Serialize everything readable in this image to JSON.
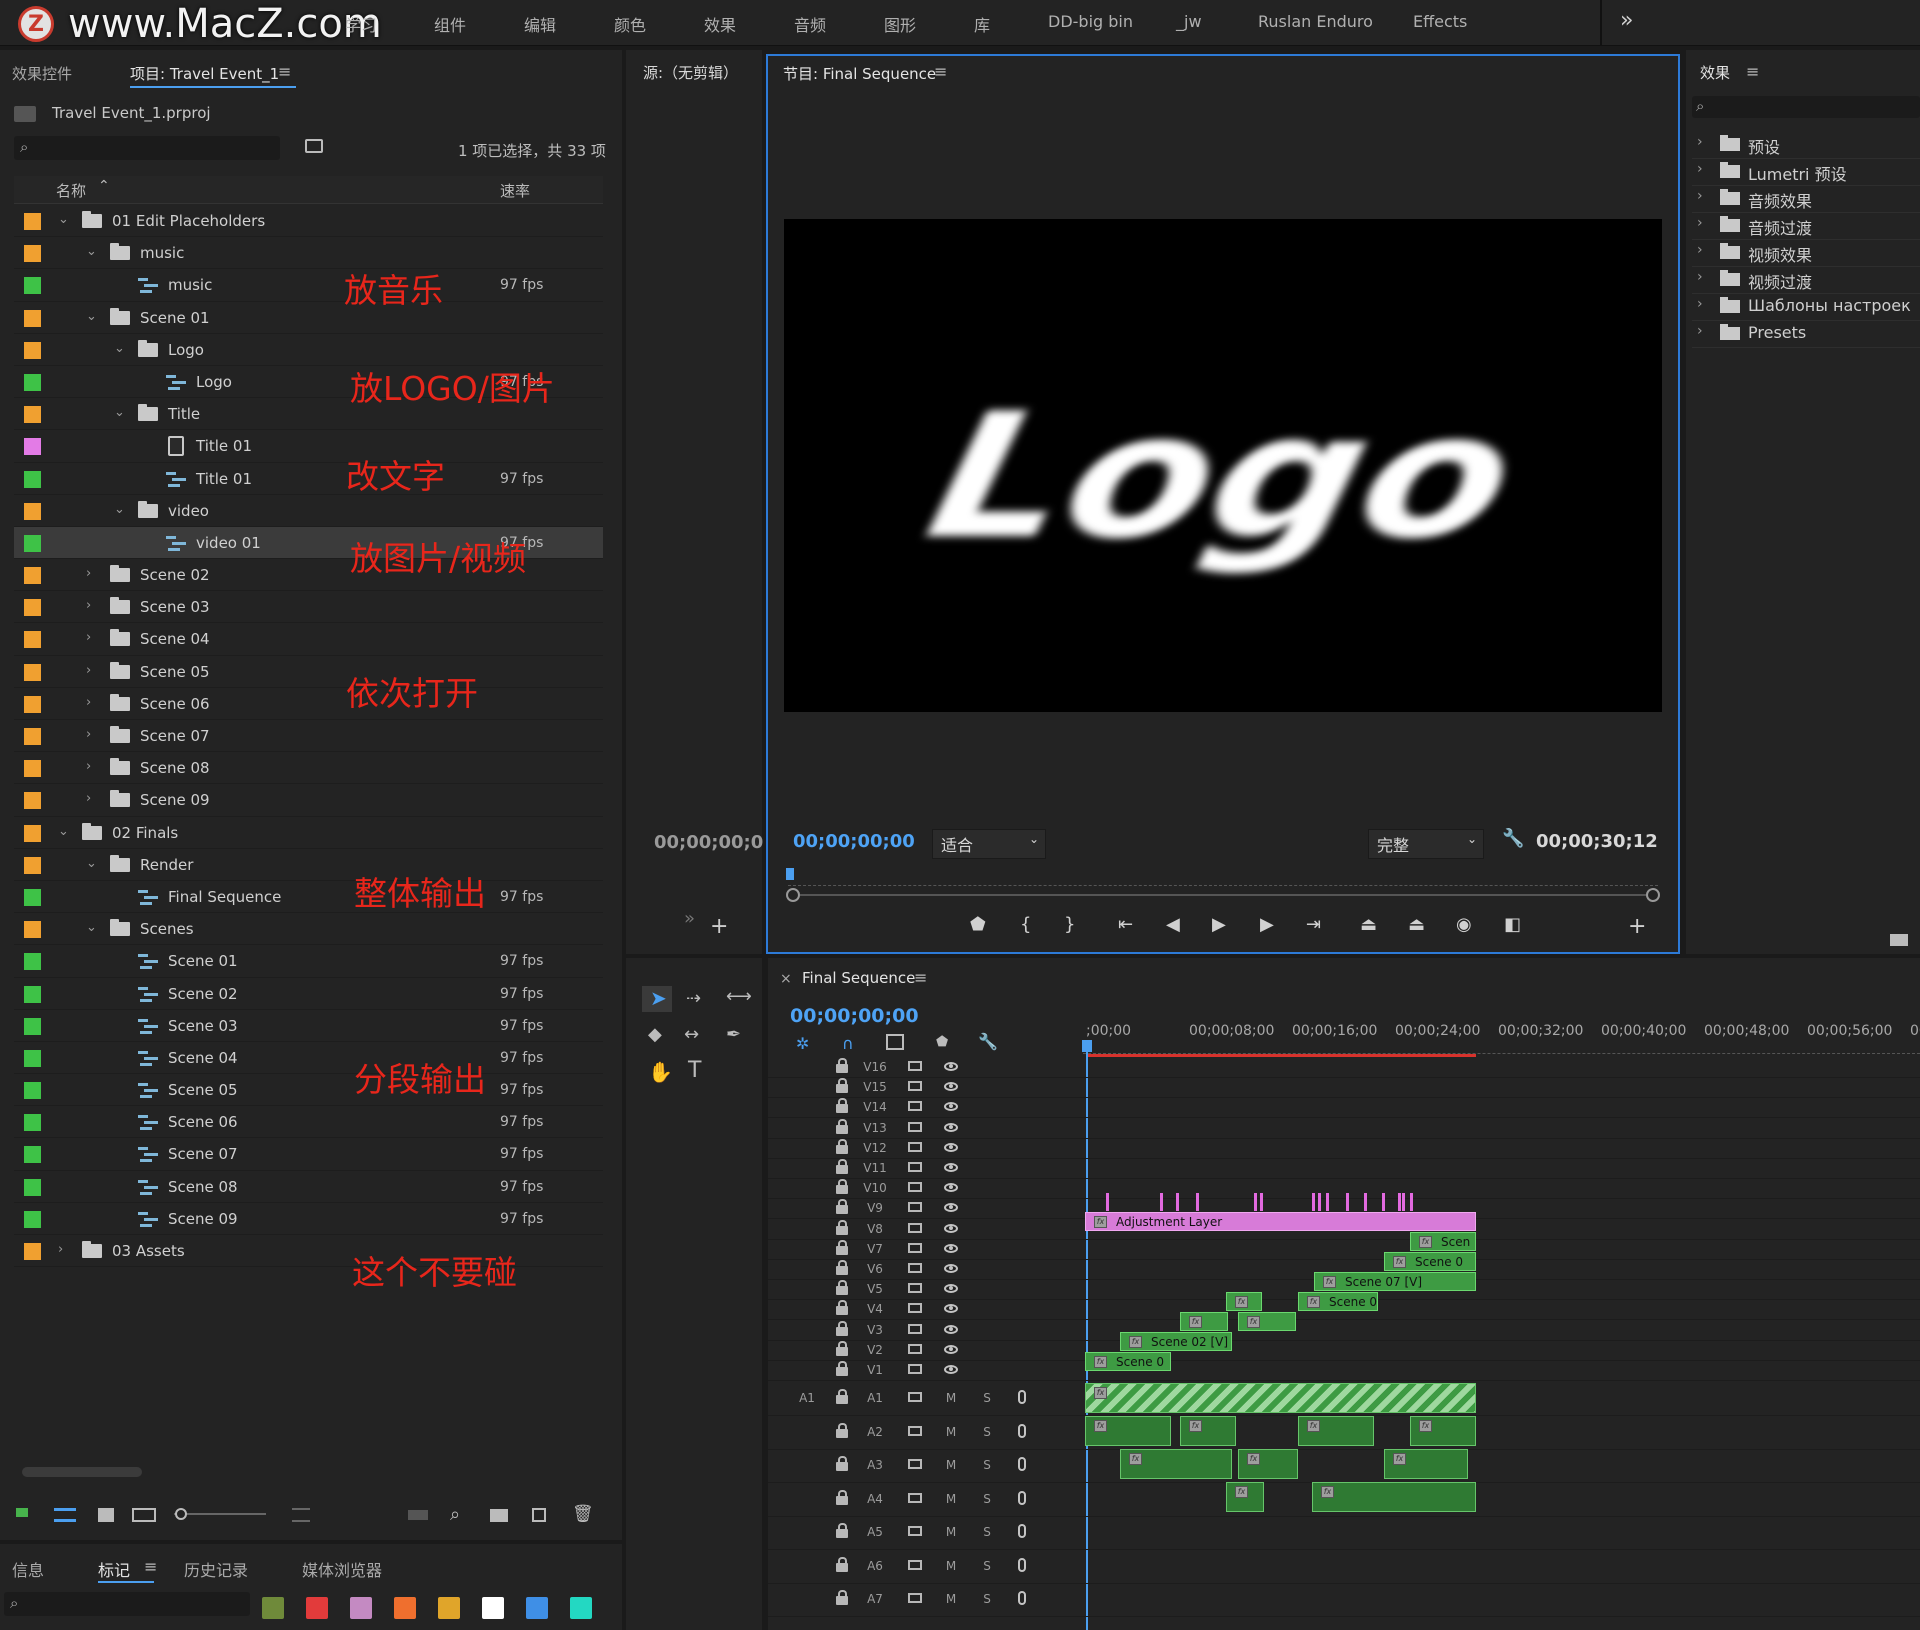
{
  "watermark": {
    "logo_letter": "Z",
    "text": "www.MacZ.com"
  },
  "workspace_tabs": [
    "学习",
    "组件",
    "编辑",
    "颜色",
    "效果",
    "音频",
    "图形",
    "库",
    "DD-big bin",
    "_jw",
    "Ruslan Enduro",
    "Effects"
  ],
  "workspace_more": "»",
  "project_panel": {
    "tab_effect_controls": "效果控件",
    "tab_project": "项目: Travel Event_1",
    "file_name": "Travel Event_1.prproj",
    "selection_status": "1 项已选择，共 33 项",
    "col_name": "名称",
    "col_rate": "速率",
    "rows": [
      {
        "name": "01 Edit Placeholders",
        "type": "bin",
        "indent": 0,
        "chip": "#f0a030",
        "twirl": "open",
        "fps": ""
      },
      {
        "name": "music",
        "type": "bin",
        "indent": 1,
        "chip": "#f0a030",
        "twirl": "open",
        "fps": ""
      },
      {
        "name": "music",
        "type": "seq",
        "indent": 2,
        "chip": "#3ec247",
        "twirl": "",
        "fps": "97 fps"
      },
      {
        "name": "Scene 01",
        "type": "bin",
        "indent": 1,
        "chip": "#f0a030",
        "twirl": "open",
        "fps": ""
      },
      {
        "name": "Logo",
        "type": "bin",
        "indent": 2,
        "chip": "#f0a030",
        "twirl": "open",
        "fps": ""
      },
      {
        "name": "Logo",
        "type": "seq",
        "indent": 3,
        "chip": "#3ec247",
        "twirl": "",
        "fps": "97 fps"
      },
      {
        "name": "Title",
        "type": "bin",
        "indent": 2,
        "chip": "#f0a030",
        "twirl": "open",
        "fps": ""
      },
      {
        "name": "Title 01",
        "type": "title",
        "indent": 3,
        "chip": "#e37be6",
        "twirl": "",
        "fps": ""
      },
      {
        "name": "Title 01",
        "type": "seq",
        "indent": 3,
        "chip": "#3ec247",
        "twirl": "",
        "fps": "97 fps"
      },
      {
        "name": "video",
        "type": "bin",
        "indent": 2,
        "chip": "#f0a030",
        "twirl": "open",
        "fps": ""
      },
      {
        "name": "video 01",
        "type": "seq",
        "indent": 3,
        "chip": "#3ec247",
        "twirl": "",
        "fps": "97 fps",
        "selected": true
      },
      {
        "name": "Scene 02",
        "type": "bin",
        "indent": 1,
        "chip": "#f0a030",
        "twirl": "closed",
        "fps": ""
      },
      {
        "name": "Scene 03",
        "type": "bin",
        "indent": 1,
        "chip": "#f0a030",
        "twirl": "closed",
        "fps": ""
      },
      {
        "name": "Scene 04",
        "type": "bin",
        "indent": 1,
        "chip": "#f0a030",
        "twirl": "closed",
        "fps": ""
      },
      {
        "name": "Scene 05",
        "type": "bin",
        "indent": 1,
        "chip": "#f0a030",
        "twirl": "closed",
        "fps": ""
      },
      {
        "name": "Scene 06",
        "type": "bin",
        "indent": 1,
        "chip": "#f0a030",
        "twirl": "closed",
        "fps": ""
      },
      {
        "name": "Scene 07",
        "type": "bin",
        "indent": 1,
        "chip": "#f0a030",
        "twirl": "closed",
        "fps": ""
      },
      {
        "name": "Scene 08",
        "type": "bin",
        "indent": 1,
        "chip": "#f0a030",
        "twirl": "closed",
        "fps": ""
      },
      {
        "name": "Scene 09",
        "type": "bin",
        "indent": 1,
        "chip": "#f0a030",
        "twirl": "closed",
        "fps": ""
      },
      {
        "name": "02 Finals",
        "type": "bin",
        "indent": 0,
        "chip": "#f0a030",
        "twirl": "open",
        "fps": ""
      },
      {
        "name": "Render",
        "type": "bin",
        "indent": 1,
        "chip": "#f0a030",
        "twirl": "open",
        "fps": ""
      },
      {
        "name": "Final Sequence",
        "type": "seq",
        "indent": 2,
        "chip": "#3ec247",
        "twirl": "",
        "fps": "97 fps"
      },
      {
        "name": "Scenes",
        "type": "bin",
        "indent": 1,
        "chip": "#f0a030",
        "twirl": "open",
        "fps": ""
      },
      {
        "name": "Scene 01",
        "type": "seq",
        "indent": 2,
        "chip": "#3ec247",
        "twirl": "",
        "fps": "97 fps"
      },
      {
        "name": "Scene 02",
        "type": "seq",
        "indent": 2,
        "chip": "#3ec247",
        "twirl": "",
        "fps": "97 fps"
      },
      {
        "name": "Scene 03",
        "type": "seq",
        "indent": 2,
        "chip": "#3ec247",
        "twirl": "",
        "fps": "97 fps"
      },
      {
        "name": "Scene 04",
        "type": "seq",
        "indent": 2,
        "chip": "#3ec247",
        "twirl": "",
        "fps": "97 fps"
      },
      {
        "name": "Scene 05",
        "type": "seq",
        "indent": 2,
        "chip": "#3ec247",
        "twirl": "",
        "fps": "97 fps"
      },
      {
        "name": "Scene 06",
        "type": "seq",
        "indent": 2,
        "chip": "#3ec247",
        "twirl": "",
        "fps": "97 fps"
      },
      {
        "name": "Scene 07",
        "type": "seq",
        "indent": 2,
        "chip": "#3ec247",
        "twirl": "",
        "fps": "97 fps"
      },
      {
        "name": "Scene 08",
        "type": "seq",
        "indent": 2,
        "chip": "#3ec247",
        "twirl": "",
        "fps": "97 fps"
      },
      {
        "name": "Scene 09",
        "type": "seq",
        "indent": 2,
        "chip": "#3ec247",
        "twirl": "",
        "fps": "97 fps"
      },
      {
        "name": "03 Assets",
        "type": "bin",
        "indent": 0,
        "chip": "#f0a030",
        "twirl": "closed",
        "fps": ""
      }
    ]
  },
  "annotations": [
    "放音乐",
    "放LOGO/图片",
    "改文字",
    "放图片/视频",
    "依次打开",
    "整体输出",
    "分段输出",
    "这个不要碰"
  ],
  "bottom_panel": {
    "tabs": [
      "信息",
      "标记",
      "历史记录",
      "媒体浏览器"
    ],
    "label_colors": [
      "#6f8a3a",
      "#e23b3b",
      "#c48ac2",
      "#ef6f2e",
      "#e0a52a",
      "#ffffff",
      "#3f8fe6",
      "#23d8c2"
    ]
  },
  "source_monitor": {
    "title": "源:（无剪辑）",
    "timecode": "00;00;00;0",
    "chevron": "»",
    "add": "+"
  },
  "program_monitor": {
    "title": "节目: Final Sequence",
    "frame_text": "Logo",
    "timecode": "00;00;00;00",
    "fit": "适合",
    "quality": "完整",
    "duration": "00;00;30;12"
  },
  "effects_panel": {
    "title": "效果",
    "items": [
      "预设",
      "Lumetri 预设",
      "音频效果",
      "音频过渡",
      "视频效果",
      "视频过渡",
      "Шаблоны настроек",
      "Presets"
    ]
  },
  "timeline": {
    "tab": "Final Sequence",
    "timecode": "00;00;00;00",
    "ruler": [
      ";00;00",
      "00;00;08;00",
      "00;00;16;00",
      "00;00;24;00",
      "00;00;32;00",
      "00;00;40;00",
      "00;00;48;00",
      "00;00;56;00",
      "00;01;0"
    ],
    "video_tracks": [
      "V16",
      "V15",
      "V14",
      "V13",
      "V12",
      "V11",
      "V10",
      "V9",
      "V8",
      "V7",
      "V6",
      "V5",
      "V4",
      "V3",
      "V2",
      "V1"
    ],
    "audio_tracks": [
      "A1",
      "A2",
      "A3",
      "A4",
      "A5",
      "A6",
      "A7"
    ],
    "source_patch": "A1",
    "mute": "M",
    "solo": "S",
    "clips": {
      "adjustment": "Adjustment Layer",
      "v7": "Scen",
      "v6": "Scene 0",
      "v5": "Scene 07 [V]",
      "v4": "Scene 0",
      "v2": "Scene 02 [V]",
      "v1": "Scene 0",
      "fx": "fx"
    }
  }
}
